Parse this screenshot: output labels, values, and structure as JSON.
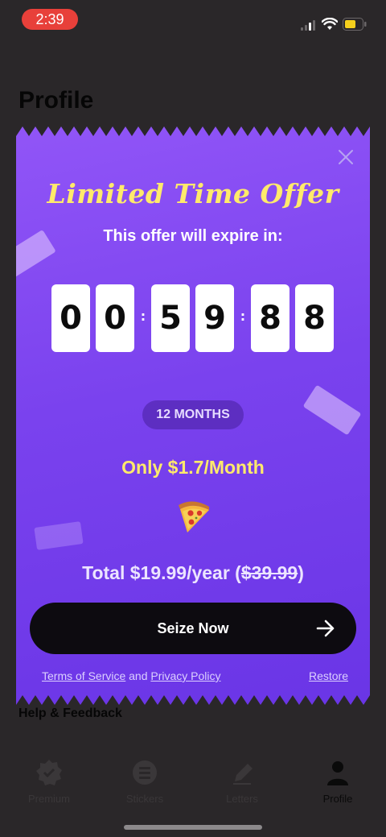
{
  "status_bar": {
    "time": "2:39",
    "battery_color": "#f5cf1c",
    "time_pill_color": "#e8403a"
  },
  "background_page": {
    "title": "Profile",
    "section_help": "Help & Feedback",
    "nav": [
      {
        "label": "Premium",
        "icon": "badge-check-icon",
        "active": false
      },
      {
        "label": "Stickers",
        "icon": "sticker-icon",
        "active": false
      },
      {
        "label": "Letters",
        "icon": "pen-icon",
        "active": false
      },
      {
        "label": "Profile",
        "icon": "person-icon",
        "active": true
      }
    ]
  },
  "offer": {
    "title": "Limited Time Offer",
    "subtitle": "This offer will expire in:",
    "countdown": {
      "digits": [
        "0",
        "0",
        "5",
        "9",
        "8",
        "8"
      ],
      "separator": ":"
    },
    "plan_label": "12 MONTHS",
    "monthly_price": "Only $1.7/Month",
    "food_icon": "pizza-icon",
    "total_prefix": "Total $19.99/year (",
    "total_original": "$39.99",
    "total_suffix": ")",
    "cta_label": "Seize Now",
    "terms_label": "Terms of Service",
    "and_text": " and ",
    "privacy_label": "Privacy Policy",
    "restore_label": "Restore",
    "colors": {
      "modal_gradient_top": "#9155f7",
      "modal_gradient_bottom": "#6a35e6",
      "accent_yellow": "#ffea6b",
      "cta_background": "#0d0b10"
    }
  }
}
